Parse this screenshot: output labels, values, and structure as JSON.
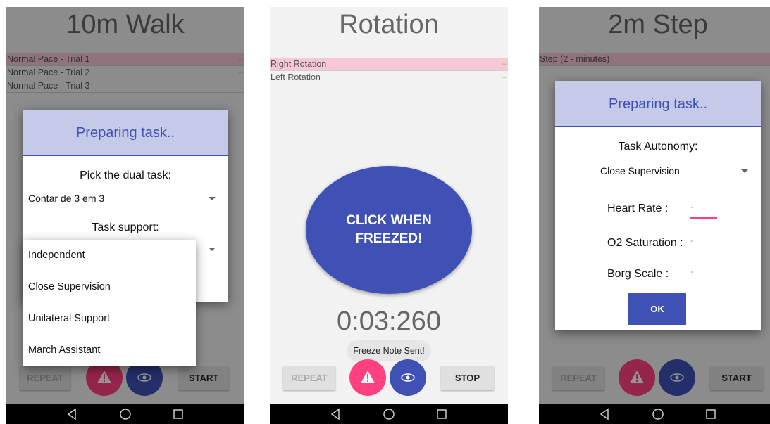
{
  "screen1": {
    "title": "10m Walk",
    "trials": [
      {
        "label": "Normal Pace - Trial 1",
        "status": "--"
      },
      {
        "label": "Normal Pace - Trial 2",
        "status": "--"
      },
      {
        "label": "Normal Pace - Trial 3",
        "status": "--"
      }
    ],
    "dialog": {
      "title": "Preparing task..",
      "dual_task_label": "Pick the dual task:",
      "dual_task_value": "Contar de 3 em 3",
      "support_label": "Task support:"
    },
    "support_options": [
      "Independent",
      "Close Supervision",
      "Unilateral Support",
      "March Assistant"
    ],
    "repeat_label": "REPEAT",
    "start_label": "START"
  },
  "screen2": {
    "title": "Rotation",
    "trials": [
      {
        "label": "Right Rotation",
        "status": "--"
      },
      {
        "label": "Left Rotation",
        "status": "--"
      }
    ],
    "big_button_line1": "CLICK WHEN",
    "big_button_line2": "FREEZED!",
    "timer": "0:03:260",
    "toast": "Freeze Note Sent!",
    "repeat_label": "REPEAT",
    "stop_label": "STOP"
  },
  "screen3": {
    "title": "2m Step",
    "trials": [
      {
        "label": "Step (2 - minutes)",
        "status": ""
      }
    ],
    "dialog": {
      "title": "Preparing task..",
      "autonomy_label": "Task Autonomy:",
      "autonomy_value": "Close Supervision",
      "heart_rate_label": "Heart Rate :",
      "heart_rate_value": "-",
      "o2_label": "O2 Saturation :",
      "o2_value": "-",
      "borg_label": "Borg Scale :",
      "borg_value": "-",
      "ok_label": "OK"
    },
    "repeat_label": "REPEAT",
    "start_label": "START"
  },
  "colors": {
    "primary": "#3f51b5",
    "accent": "#ff4081",
    "dialog_header": "#c5cae9",
    "selected_row": "#f8c8d4"
  },
  "icons": [
    "warning-icon",
    "eye-icon",
    "back-icon",
    "home-icon",
    "recents-icon"
  ]
}
